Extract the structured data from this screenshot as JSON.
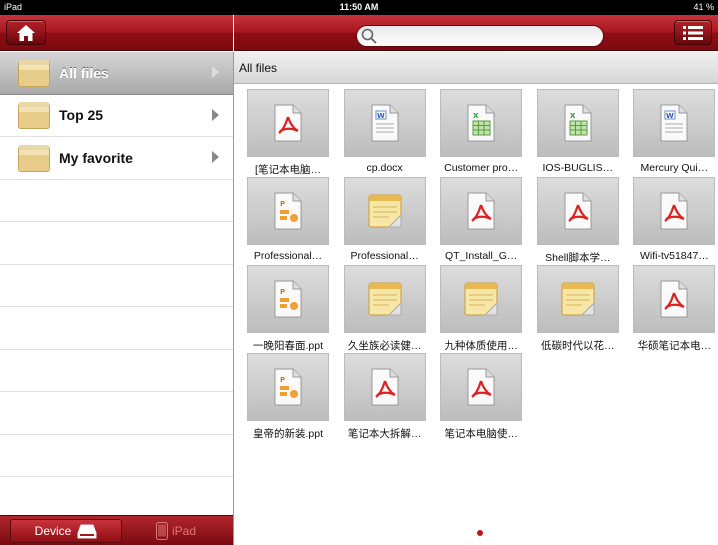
{
  "statusbar": {
    "device": "iPad",
    "time": "11:50 AM",
    "battery": "41 %"
  },
  "toolbar": {
    "home_icon": "home-icon",
    "list_icon": "list-view-icon",
    "search_placeholder": ""
  },
  "sidebar": {
    "items": [
      {
        "label": "All files",
        "selected": true
      },
      {
        "label": "Top 25",
        "selected": false
      },
      {
        "label": "My favorite",
        "selected": false
      }
    ]
  },
  "tabs": {
    "device": "Device",
    "ipad": "iPad"
  },
  "content": {
    "path": "All files",
    "files": [
      {
        "name": "[笔记本电脑…",
        "type": "pdf"
      },
      {
        "name": "cp.docx",
        "type": "doc"
      },
      {
        "name": "Customer pro…",
        "type": "xls"
      },
      {
        "name": "IOS-BUGLIS…",
        "type": "xls"
      },
      {
        "name": "Mercury  Qui…",
        "type": "doc"
      },
      {
        "name": "Professional…",
        "type": "ppt"
      },
      {
        "name": "Professional…",
        "type": "note"
      },
      {
        "name": "QT_Install_G…",
        "type": "pdf"
      },
      {
        "name": "Shell脚本学…",
        "type": "pdf"
      },
      {
        "name": "Wifi-tv51847…",
        "type": "pdf"
      },
      {
        "name": "一晚阳春面.ppt",
        "type": "ppt"
      },
      {
        "name": "久坐族必读健…",
        "type": "note"
      },
      {
        "name": "九种体质使用…",
        "type": "note"
      },
      {
        "name": "低碳时代以花…",
        "type": "note"
      },
      {
        "name": "华硕笔记本电…",
        "type": "pdf"
      },
      {
        "name": "皇帝的新装.ppt",
        "type": "ppt"
      },
      {
        "name": "笔记本大拆解…",
        "type": "pdf"
      },
      {
        "name": "笔记本电脑使…",
        "type": "pdf"
      }
    ]
  }
}
